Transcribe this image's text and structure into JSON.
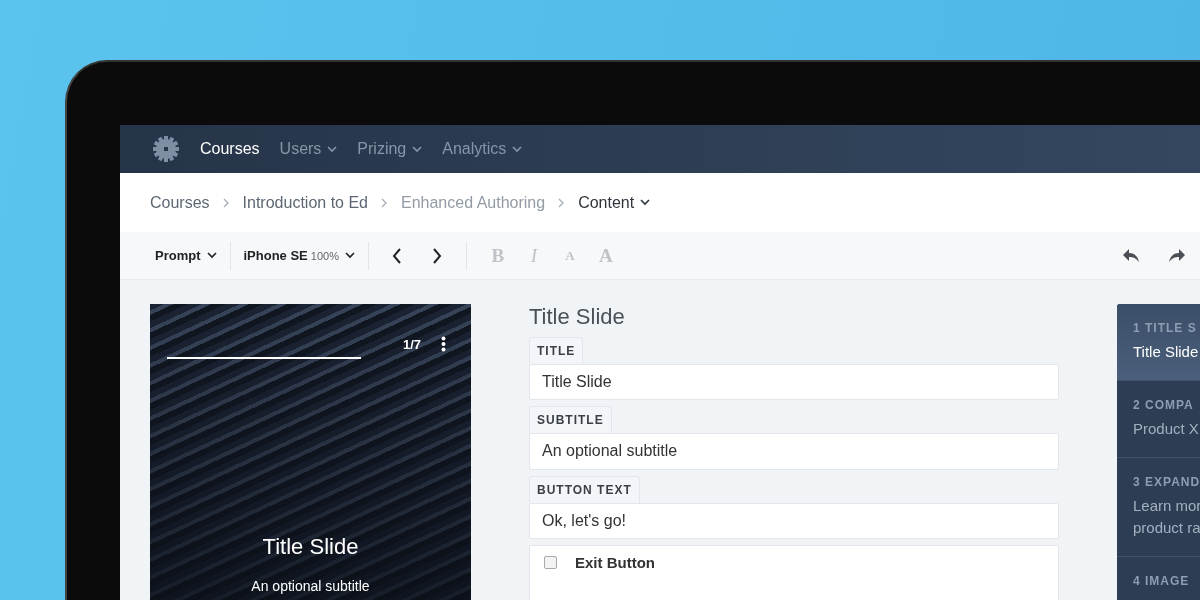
{
  "nav": {
    "items": [
      {
        "label": "Courses",
        "selected": true,
        "has_menu": false
      },
      {
        "label": "Users",
        "selected": false,
        "has_menu": true
      },
      {
        "label": "Prizing",
        "selected": false,
        "has_menu": true
      },
      {
        "label": "Analytics",
        "selected": false,
        "has_menu": true
      }
    ]
  },
  "breadcrumbs": [
    {
      "label": "Courses",
      "kind": "link"
    },
    {
      "label": "Introduction to Ed",
      "kind": "link"
    },
    {
      "label": "Enhanced Authoring",
      "kind": "muted"
    },
    {
      "label": "Content",
      "kind": "current"
    }
  ],
  "toolbar": {
    "prompt": "Prompt",
    "device": "iPhone SE",
    "zoom": "100%",
    "format_buttons": [
      {
        "label": "B",
        "kind": "bold",
        "disabled": true
      },
      {
        "label": "I",
        "kind": "italic",
        "disabled": true
      },
      {
        "label": "A",
        "kind": "small",
        "disabled": true
      },
      {
        "label": "A",
        "kind": "large",
        "disabled": true
      }
    ]
  },
  "preview": {
    "counter": "1/7",
    "title": "Title Slide",
    "subtitle": "An optional subtitle"
  },
  "form": {
    "heading": "Title Slide",
    "fields": [
      {
        "label": "TITLE",
        "value": "Title Slide"
      },
      {
        "label": "SUBTITLE",
        "value": "An optional subtitle"
      },
      {
        "label": "BUTTON TEXT",
        "value": "Ok, let's go!"
      }
    ],
    "checkbox": {
      "label": "Exit Button",
      "checked": false
    }
  },
  "slides": [
    {
      "heading": "1 TITLE S",
      "lines": [
        "Title Slide"
      ],
      "selected": true
    },
    {
      "heading": "2 COMPA",
      "lines": [
        "Product X"
      ],
      "selected": false
    },
    {
      "heading": "3 EXPAND",
      "lines": [
        "Learn mor",
        "product ra"
      ],
      "selected": false
    },
    {
      "heading": "4 IMAGE",
      "selected": false
    }
  ]
}
